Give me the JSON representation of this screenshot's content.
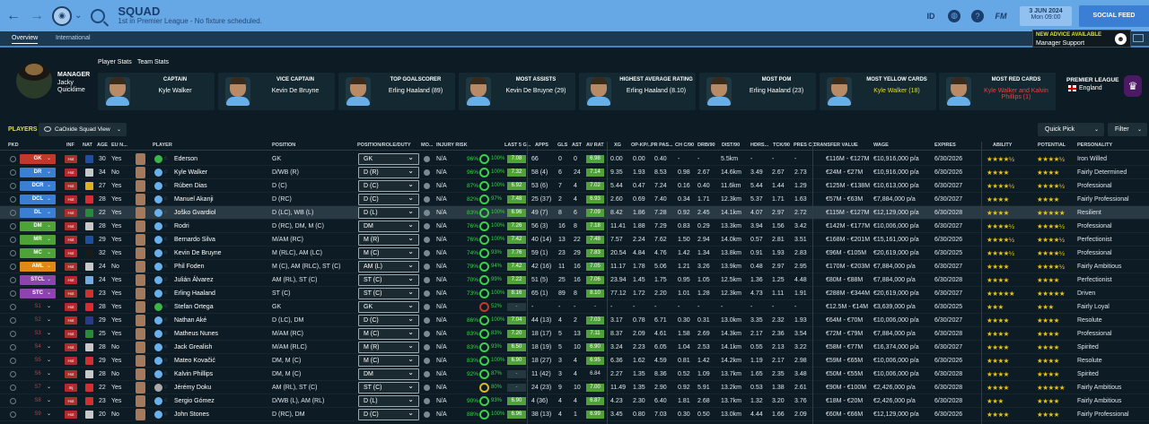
{
  "topbar": {
    "title": "SQUAD",
    "subtitle": "1st in Premier League - No fixture scheduled.",
    "icons": [
      "back-icon",
      "forward-icon",
      "club-crest",
      "search-icon",
      "globe-icon",
      "help-icon",
      "fm-icon"
    ],
    "id_label": "ID",
    "fm_label": "FM",
    "date": "3 JUN 2024",
    "day": "Mon 09:00",
    "social_feed": "SOCIAL FEED"
  },
  "tabs": [
    {
      "label": "Overview",
      "active": true
    },
    {
      "label": "International",
      "active": false
    }
  ],
  "advice": {
    "title": "NEW ADVICE AVAILABLE",
    "text": "Manager Support"
  },
  "manager": {
    "label": "MANAGER",
    "first": "Jacky",
    "last": "Quicklime"
  },
  "stat_tabs": {
    "player": "Player Stats",
    "team": "Team Stats"
  },
  "cards": [
    {
      "header": "CAPTAIN",
      "value": "Kyle Walker",
      "style": ""
    },
    {
      "header": "VICE CAPTAIN",
      "value": "Kevin De Bruyne",
      "style": ""
    },
    {
      "header": "TOP GOALSCORER",
      "value": "Erling Haaland (89)",
      "style": ""
    },
    {
      "header": "MOST ASSISTS",
      "value": "Kevin De Bruyne (29)",
      "style": ""
    },
    {
      "header": "HIGHEST AVERAGE RATING",
      "value": "Erling Haaland (8.10)",
      "style": ""
    },
    {
      "header": "MOST POM",
      "value": "Erling Haaland (23)",
      "style": ""
    },
    {
      "header": "MOST YELLOW CARDS",
      "value": "Kyle Walker (18)",
      "style": "yel"
    },
    {
      "header": "MOST RED CARDS",
      "value": "Kyle Walker and Kalvin Phillips (1)",
      "style": "red"
    }
  ],
  "league": {
    "name": "PREMIER LEAGUE",
    "country": "England"
  },
  "toolbar": {
    "players": "PLAYERS",
    "view": "CaOxide Squad View",
    "quick_pick": "Quick Pick",
    "filter": "Filter"
  },
  "columns": [
    "PKD",
    "INF",
    "NAT",
    "AGE",
    "EU N...",
    "PLAYER",
    "POSITION",
    "POSITION/ROLE/DUTY",
    "MO...",
    "INJURY RISK",
    "LAST 5 G...",
    "APPS",
    "GLS",
    "AST",
    "AV RAT",
    "XG",
    "OP-KP/...",
    "PR PAS...",
    "CH C/90",
    "DRB/90",
    "DIST/90",
    "HDRS...",
    "TCK/90",
    "PRES C...",
    "TRANSFER VALUE",
    "WAGE",
    "EXPIRES",
    "ABILITY",
    "POTENTIAL",
    "PERSONALITY"
  ],
  "colors": {
    "accent": "#66a7e6",
    "gk": "#c0392b",
    "def": "#3a7fd3",
    "mid": "#4fa237",
    "att": "#e08a16",
    "st": "#8e44ad"
  },
  "players": [
    {
      "pkd": "GK",
      "pcol": "#c0392b",
      "inf": "Hot",
      "age": "30",
      "eu": "Yes",
      "name": "Ederson",
      "pos": "GK",
      "role": "GK",
      "inj": "N/A",
      "pct": "96%",
      "cond": "100%",
      "l5": "7.08",
      "apps": "66",
      "gls": "0",
      "ast": "0",
      "av": "6.98",
      "xg": "0.00",
      "dp": "0.00",
      "pr": "0.40",
      "chc": "-",
      "drb": "-",
      "dist": "5.5km",
      "hdr": "-",
      "tck": "-",
      "prs": "-",
      "val": "€116M - €127M",
      "wage": "€10,916,000 p/a",
      "exp": "6/30/2026",
      "abil": "★★★★½",
      "pot": "★★★★½",
      "pers": "Iron Willed",
      "gk": true
    },
    {
      "pkd": "DR",
      "pcol": "#3a7fd3",
      "inf": "Hot",
      "age": "34",
      "eu": "No",
      "name": "Kyle Walker",
      "pos": "D/WB (R)",
      "role": "D (R)",
      "inj": "N/A",
      "pct": "96%",
      "cond": "100%",
      "l5": "7.32",
      "apps": "58 (4)",
      "gls": "6",
      "ast": "24",
      "av": "7.14",
      "xg": "9.35",
      "dp": "1.93",
      "pr": "8.53",
      "chc": "0.98",
      "drb": "2.67",
      "dist": "14.6km",
      "hdr": "3.49",
      "tck": "2.67",
      "prs": "2.73",
      "val": "€24M - €27M",
      "wage": "€10,916,000 p/a",
      "exp": "6/30/2026",
      "abil": "★★★★",
      "pot": "★★★★",
      "pers": "Fairly Determined"
    },
    {
      "pkd": "DCR",
      "pcol": "#3a7fd3",
      "inf": "Hot",
      "age": "27",
      "eu": "Yes",
      "name": "Rúben Dias",
      "pos": "D (C)",
      "role": "D (C)",
      "inj": "N/A",
      "pct": "87%",
      "cond": "100%",
      "l5": "6.92",
      "apps": "53 (6)",
      "gls": "7",
      "ast": "4",
      "av": "7.02",
      "xg": "5.44",
      "dp": "0.47",
      "pr": "7.24",
      "chc": "0.16",
      "drb": "0.40",
      "dist": "11.6km",
      "hdr": "5.44",
      "tck": "1.44",
      "prs": "1.29",
      "val": "€125M - €138M",
      "wage": "€10,613,000 p/a",
      "exp": "6/30/2027",
      "abil": "★★★★½",
      "pot": "★★★★½",
      "pers": "Professional"
    },
    {
      "pkd": "DCL",
      "pcol": "#3a7fd3",
      "inf": "Hot",
      "age": "28",
      "eu": "Yes",
      "name": "Manuel Akanji",
      "pos": "D (RC)",
      "role": "D (C)",
      "inj": "N/A",
      "pct": "82%",
      "cond": "97%",
      "l5": "7.48",
      "apps": "25 (37)",
      "gls": "2",
      "ast": "4",
      "av": "6.93",
      "xg": "2.60",
      "dp": "0.69",
      "pr": "7.40",
      "chc": "0.34",
      "drb": "1.71",
      "dist": "12.3km",
      "hdr": "5.37",
      "tck": "1.71",
      "prs": "1.63",
      "val": "€57M - €63M",
      "wage": "€7,884,000 p/a",
      "exp": "6/30/2027",
      "abil": "★★★★",
      "pot": "★★★★",
      "pers": "Fairly Professional"
    },
    {
      "pkd": "DL",
      "pcol": "#3a7fd3",
      "inf": "Hot",
      "age": "22",
      "eu": "Yes",
      "name": "Joško Gvardiol",
      "pos": "D (LC), WB (L)",
      "role": "D (L)",
      "inj": "N/A",
      "pct": "83%",
      "cond": "100%",
      "l5": "6.96",
      "apps": "49 (7)",
      "gls": "8",
      "ast": "6",
      "av": "7.09",
      "xg": "8.42",
      "dp": "1.86",
      "pr": "7.28",
      "chc": "0.92",
      "drb": "2.45",
      "dist": "14.1km",
      "hdr": "4.07",
      "tck": "2.97",
      "prs": "2.72",
      "val": "€115M - €127M",
      "wage": "€12,129,000 p/a",
      "exp": "6/30/2028",
      "abil": "★★★★",
      "pot": "★★★★★",
      "pers": "Resilient",
      "sel": true
    },
    {
      "pkd": "DM",
      "pcol": "#4fa237",
      "inf": "Hot",
      "age": "28",
      "eu": "Yes",
      "name": "Rodri",
      "pos": "D (RC), DM, M (C)",
      "role": "DM",
      "inj": "N/A",
      "pct": "76%",
      "cond": "100%",
      "l5": "7.26",
      "apps": "56 (3)",
      "gls": "16",
      "ast": "8",
      "av": "7.18",
      "xg": "11.41",
      "dp": "1.88",
      "pr": "7.29",
      "chc": "0.83",
      "drb": "0.29",
      "dist": "13.3km",
      "hdr": "3.94",
      "tck": "1.56",
      "prs": "3.42",
      "val": "€142M - €177M",
      "wage": "€10,006,000 p/a",
      "exp": "6/30/2027",
      "abil": "★★★★½",
      "pot": "★★★★½",
      "pers": "Professional"
    },
    {
      "pkd": "MR",
      "pcol": "#4fa237",
      "inf": "Hot",
      "age": "29",
      "eu": "Yes",
      "name": "Bernardo Silva",
      "pos": "M/AM (RC)",
      "role": "M (R)",
      "inj": "N/A",
      "pct": "76%",
      "cond": "100%",
      "l5": "7.42",
      "apps": "40 (14)",
      "gls": "13",
      "ast": "22",
      "av": "7.48",
      "xg": "7.57",
      "dp": "2.24",
      "pr": "7.62",
      "chc": "1.50",
      "drb": "2.94",
      "dist": "14.0km",
      "hdr": "0.57",
      "tck": "2.81",
      "prs": "3.51",
      "val": "€168M - €201M",
      "wage": "€15,161,000 p/a",
      "exp": "6/30/2026",
      "abil": "★★★★½",
      "pot": "★★★★½",
      "pers": "Perfectionist"
    },
    {
      "pkd": "MC",
      "pcol": "#4fa237",
      "inf": "Hot",
      "age": "32",
      "eu": "Yes",
      "name": "Kevin De Bruyne",
      "pos": "M (RLC), AM (LC)",
      "role": "M (C)",
      "inj": "N/A",
      "pct": "74%",
      "cond": "93%",
      "l5": "7.76",
      "apps": "59 (1)",
      "gls": "23",
      "ast": "29",
      "av": "7.83",
      "xg": "20.54",
      "dp": "4.84",
      "pr": "4.76",
      "chc": "1.42",
      "drb": "1.34",
      "dist": "13.8km",
      "hdr": "0.91",
      "tck": "1.93",
      "prs": "2.83",
      "val": "€96M - €105M",
      "wage": "€20,619,000 p/a",
      "exp": "6/30/2025",
      "abil": "★★★★½",
      "pot": "★★★★½",
      "pers": "Professional"
    },
    {
      "pkd": "AML",
      "pcol": "#e08a16",
      "inf": "Hot",
      "age": "24",
      "eu": "No",
      "name": "Phil Foden",
      "pos": "M (C), AM (RLC), ST (C)",
      "role": "AM (L)",
      "inj": "N/A",
      "pct": "79%",
      "cond": "94%",
      "l5": "7.42",
      "apps": "42 (16)",
      "gls": "11",
      "ast": "16",
      "av": "7.05",
      "xg": "11.17",
      "dp": "1.78",
      "pr": "5.06",
      "chc": "1.21",
      "drb": "3.26",
      "dist": "13.9km",
      "hdr": "0.48",
      "tck": "2.97",
      "prs": "2.95",
      "val": "€170M - €203M",
      "wage": "€7,884,000 p/a",
      "exp": "6/30/2027",
      "abil": "★★★★",
      "pot": "★★★★½",
      "pers": "Fairly Ambitious"
    },
    {
      "pkd": "STCL",
      "pcol": "#8e44ad",
      "inf": "Hot",
      "age": "24",
      "eu": "Yes",
      "name": "Julián Álvarez",
      "pos": "AM (RL), ST (C)",
      "role": "ST (C)",
      "inj": "N/A",
      "pct": "70%",
      "cond": "99%",
      "l5": "7.22",
      "apps": "51 (5)",
      "gls": "25",
      "ast": "16",
      "av": "7.06",
      "xg": "23.94",
      "dp": "1.45",
      "pr": "1.75",
      "chc": "0.95",
      "drb": "1.05",
      "dist": "12.5km",
      "hdr": "1.36",
      "tck": "1.25",
      "prs": "4.48",
      "val": "€80M - €88M",
      "wage": "€7,884,000 p/a",
      "exp": "6/30/2028",
      "abil": "★★★★",
      "pot": "★★★★",
      "pers": "Perfectionist"
    },
    {
      "pkd": "STC",
      "pcol": "#8e44ad",
      "inf": "Hot",
      "age": "23",
      "eu": "Yes",
      "name": "Erling Haaland",
      "pos": "ST (C)",
      "role": "ST (C)",
      "inj": "N/A",
      "pct": "73%",
      "cond": "100%",
      "l5": "8.16",
      "apps": "65 (1)",
      "gls": "89",
      "ast": "8",
      "av": "8.10",
      "xg": "77.12",
      "dp": "1.72",
      "pr": "2.20",
      "chc": "1.01",
      "drb": "1.28",
      "dist": "12.3km",
      "hdr": "4.73",
      "tck": "1.11",
      "prs": "1.91",
      "val": "€288M - €344M",
      "wage": "€20,619,000 p/a",
      "exp": "6/30/2027",
      "abil": "★★★★★",
      "pot": "★★★★★",
      "pers": "Driven"
    },
    {
      "pkd": "S1",
      "pcol": "",
      "inf": "Hot",
      "age": "28",
      "eu": "Yes",
      "name": "Stefan Ortega",
      "pos": "GK",
      "role": "GK",
      "inj": "N/A",
      "pct": "",
      "cond": "52%",
      "l5": "-",
      "apps": "-",
      "gls": "-",
      "ast": "-",
      "av": "-",
      "xg": "-",
      "dp": "-",
      "pr": "-",
      "chc": "-",
      "drb": "-",
      "dist": "-",
      "hdr": "-",
      "tck": "-",
      "prs": "-",
      "val": "€12.5M - €14M",
      "wage": "€3,639,000 p/a",
      "exp": "6/30/2025",
      "abil": "★★★",
      "pot": "★★★",
      "pers": "Fairly Loyal",
      "gk": true,
      "ringlow": true,
      "l5dim": true,
      "avblank": true
    },
    {
      "pkd": "S2",
      "pcol": "",
      "inf": "Hot",
      "age": "29",
      "eu": "Yes",
      "name": "Nathan Aké",
      "pos": "D (LC), DM",
      "role": "D (C)",
      "inj": "N/A",
      "pct": "86%",
      "cond": "100%",
      "l5": "7.04",
      "apps": "44 (13)",
      "gls": "4",
      "ast": "2",
      "av": "7.03",
      "xg": "3.17",
      "dp": "0.78",
      "pr": "6.71",
      "chc": "0.30",
      "drb": "0.31",
      "dist": "13.0km",
      "hdr": "3.35",
      "tck": "2.32",
      "prs": "1.93",
      "val": "€64M - €70M",
      "wage": "€10,006,000 p/a",
      "exp": "6/30/2027",
      "abil": "★★★★",
      "pot": "★★★★",
      "pers": "Resolute"
    },
    {
      "pkd": "S3",
      "pcol": "",
      "inf": "Hot",
      "age": "25",
      "eu": "Yes",
      "name": "Matheus Nunes",
      "pos": "M/AM (RC)",
      "role": "M (C)",
      "inj": "N/A",
      "pct": "83%",
      "cond": "83%",
      "l5": "7.20",
      "apps": "18 (17)",
      "gls": "5",
      "ast": "13",
      "av": "7.11",
      "xg": "8.37",
      "dp": "2.09",
      "pr": "4.61",
      "chc": "1.58",
      "drb": "2.69",
      "dist": "14.3km",
      "hdr": "2.17",
      "tck": "2.36",
      "prs": "3.54",
      "val": "€72M - €79M",
      "wage": "€7,884,000 p/a",
      "exp": "6/30/2028",
      "abil": "★★★★",
      "pot": "★★★★",
      "pers": "Professional"
    },
    {
      "pkd": "S4",
      "pcol": "",
      "inf": "Hot",
      "age": "28",
      "eu": "No",
      "name": "Jack Grealish",
      "pos": "M/AM (RLC)",
      "role": "M (R)",
      "inj": "N/A",
      "pct": "83%",
      "cond": "93%",
      "l5": "6.50",
      "apps": "18 (19)",
      "gls": "5",
      "ast": "10",
      "av": "6.90",
      "xg": "3.24",
      "dp": "2.23",
      "pr": "6.05",
      "chc": "1.04",
      "drb": "2.53",
      "dist": "14.1km",
      "hdr": "0.55",
      "tck": "2.13",
      "prs": "3.22",
      "val": "€58M - €77M",
      "wage": "€16,374,000 p/a",
      "exp": "6/30/2027",
      "abil": "★★★★",
      "pot": "★★★★",
      "pers": "Spirited"
    },
    {
      "pkd": "S5",
      "pcol": "",
      "inf": "Hot",
      "age": "29",
      "eu": "Yes",
      "name": "Mateo Kovačić",
      "pos": "DM, M (C)",
      "role": "M (C)",
      "inj": "N/A",
      "pct": "83%",
      "cond": "100%",
      "l5": "6.90",
      "apps": "18 (27)",
      "gls": "3",
      "ast": "4",
      "av": "6.95",
      "xg": "6.36",
      "dp": "1.62",
      "pr": "4.59",
      "chc": "0.81",
      "drb": "1.42",
      "dist": "14.2km",
      "hdr": "1.19",
      "tck": "2.17",
      "prs": "2.98",
      "val": "€59M - €65M",
      "wage": "€10,006,000 p/a",
      "exp": "6/30/2026",
      "abil": "★★★★",
      "pot": "★★★★",
      "pers": "Resolute"
    },
    {
      "pkd": "S6",
      "pcol": "",
      "inf": "Hot",
      "age": "28",
      "eu": "No",
      "name": "Kalvin Phillips",
      "pos": "DM, M (C)",
      "role": "DM",
      "inj": "N/A",
      "pct": "92%",
      "cond": "87%",
      "l5": "-",
      "apps": "11 (42)",
      "gls": "3",
      "ast": "4",
      "av": "6.84",
      "xg": "2.27",
      "dp": "1.35",
      "pr": "8.36",
      "chc": "0.52",
      "drb": "1.09",
      "dist": "13.7km",
      "hdr": "1.65",
      "tck": "2.35",
      "prs": "3.48",
      "val": "€50M - €55M",
      "wage": "€10,006,000 p/a",
      "exp": "6/30/2028",
      "abil": "★★★★",
      "pot": "★★★★",
      "pers": "Spirited",
      "l5dim": true,
      "avblank": true
    },
    {
      "pkd": "S7",
      "pcol": "",
      "inf": "Inj",
      "age": "22",
      "eu": "Yes",
      "name": "Jérémy Doku",
      "pos": "AM (RL), ST (C)",
      "role": "ST (C)",
      "inj": "N/A",
      "pct": "",
      "cond": "80%",
      "l5": "-",
      "apps": "24 (23)",
      "gls": "9",
      "ast": "10",
      "av": "7.00",
      "xg": "11.49",
      "dp": "1.35",
      "pr": "2.90",
      "chc": "0.92",
      "drb": "5.91",
      "dist": "13.2km",
      "hdr": "0.53",
      "tck": "1.38",
      "prs": "2.61",
      "val": "€90M - €100M",
      "wage": "€2,426,000 p/a",
      "exp": "6/30/2028",
      "abil": "★★★★",
      "pot": "★★★★★",
      "pers": "Fairly Ambitious",
      "ringmid": true,
      "l5dim": true,
      "off": true
    },
    {
      "pkd": "S8",
      "pcol": "",
      "inf": "Hot",
      "age": "23",
      "eu": "Yes",
      "name": "Sergio Gómez",
      "pos": "D/WB (L), AM (RL)",
      "role": "D (L)",
      "inj": "N/A",
      "pct": "90%",
      "cond": "93%",
      "l5": "6.90",
      "apps": "4 (36)",
      "gls": "4",
      "ast": "4",
      "av": "6.87",
      "xg": "4.23",
      "dp": "2.30",
      "pr": "6.40",
      "chc": "1.81",
      "drb": "2.68",
      "dist": "13.7km",
      "hdr": "1.32",
      "tck": "3.20",
      "prs": "3.76",
      "val": "€18M - €20M",
      "wage": "€2,426,000 p/a",
      "exp": "6/30/2028",
      "abil": "★★★",
      "pot": "★★★★",
      "pers": "Fairly Ambitious"
    },
    {
      "pkd": "S9",
      "pcol": "",
      "inf": "Hot",
      "age": "20",
      "eu": "No",
      "name": "John Stones",
      "pos": "D (RC), DM",
      "role": "D (C)",
      "inj": "N/A",
      "pct": "88%",
      "cond": "100%",
      "l5": "6.96",
      "apps": "38 (13)",
      "gls": "4",
      "ast": "1",
      "av": "6.99",
      "xg": "3.45",
      "dp": "0.80",
      "pr": "7.03",
      "chc": "0.30",
      "drb": "0.50",
      "dist": "13.0km",
      "hdr": "4.44",
      "tck": "1.66",
      "prs": "2.09",
      "val": "€60M - €66M",
      "wage": "€12,129,000 p/a",
      "exp": "6/30/2026",
      "abil": "★★★★",
      "pot": "★★★★",
      "pers": "Fairly Professional"
    }
  ]
}
